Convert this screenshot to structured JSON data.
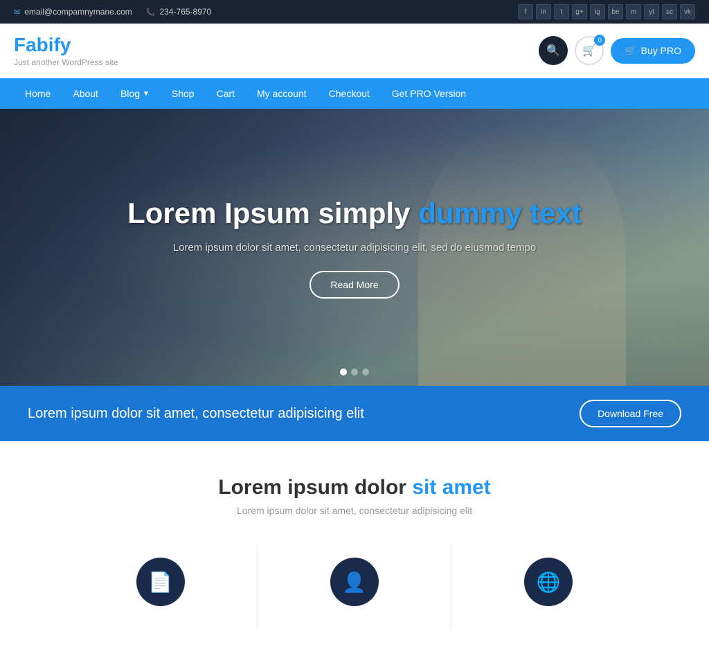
{
  "topbar": {
    "email": "email@compamnymane.com",
    "phone": "234-765-8970",
    "social_icons": [
      "f",
      "in",
      "t",
      "g+",
      "ig",
      "be",
      "m",
      "yt",
      "sc",
      "vk"
    ]
  },
  "header": {
    "logo_first": "F",
    "logo_rest": "abify",
    "tagline": "Just another WordPress site",
    "cart_count": "0",
    "buy_pro_label": "Buy PRO"
  },
  "nav": {
    "items": [
      {
        "label": "Home",
        "has_dropdown": false
      },
      {
        "label": "About",
        "has_dropdown": false
      },
      {
        "label": "Blog",
        "has_dropdown": true
      },
      {
        "label": "Shop",
        "has_dropdown": false
      },
      {
        "label": "Cart",
        "has_dropdown": false
      },
      {
        "label": "My account",
        "has_dropdown": false
      },
      {
        "label": "Checkout",
        "has_dropdown": false
      },
      {
        "label": "Get PRO Version",
        "has_dropdown": false
      }
    ]
  },
  "hero": {
    "title_part1": "Lorem Ipsum simply ",
    "title_highlight": "dummy text",
    "subtitle": "Lorem ipsum dolor sit amet, consectetur adipisicing elit, sed do eiusmod tempo",
    "cta_label": "Read More"
  },
  "cta_bar": {
    "text": "Lorem ipsum dolor sit amet, consectetur adipisicing elit",
    "button_label": "Download Free"
  },
  "features": {
    "section_title_part1": "Lorem ipsum dolor ",
    "section_title_highlight": "sit amet",
    "section_subtitle": "Lorem ipsum dolor sit amet, consectetur adipisicing elit",
    "items": [
      {
        "icon": "📄"
      },
      {
        "icon": "👤"
      },
      {
        "icon": "🌐"
      }
    ]
  }
}
